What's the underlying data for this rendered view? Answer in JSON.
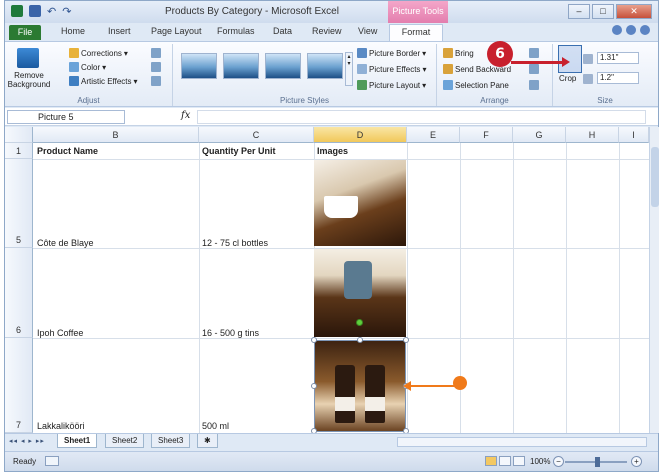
{
  "window": {
    "title": "Products By Category - Microsoft Excel",
    "context_tab": "Picture Tools",
    "buttons": [
      "–",
      "□",
      "✕"
    ]
  },
  "tabs": [
    "File",
    "Home",
    "Insert",
    "Page Layout",
    "Formulas",
    "Data",
    "Review",
    "View",
    "Format"
  ],
  "ribbon": {
    "adjust": {
      "remove_background": "Remove Background",
      "corrections": "Corrections",
      "color": "Color",
      "artistic_effects": "Artistic Effects",
      "label": "Adjust"
    },
    "picture_styles": {
      "picture_border": "Picture Border",
      "picture_effects": "Picture Effects",
      "picture_layout": "Picture Layout",
      "label": "Picture Styles"
    },
    "arrange": {
      "bring_forward": "Bring",
      "send_backward": "Send Backward",
      "selection_pane": "Selection Pane",
      "label": "Arrange"
    },
    "size": {
      "crop": "Crop",
      "height": "1.31\"",
      "width": "1.2\"",
      "label": "Size"
    }
  },
  "formula_bar": {
    "name_box": "Picture 5",
    "fx": "fx",
    "content": ""
  },
  "columns": [
    "B",
    "C",
    "D",
    "E",
    "F",
    "G",
    "H",
    "I"
  ],
  "selected_column": "D",
  "header_row": {
    "row": "1",
    "product_name": "Product Name",
    "quantity": "Quantity Per Unit",
    "images": "Images"
  },
  "rows": [
    {
      "row": "5",
      "name": "Côte de Blaye",
      "qty": "12 - 75 cl bottles"
    },
    {
      "row": "6",
      "name": "Ipoh Coffee",
      "qty": "16 - 500 g tins"
    },
    {
      "row": "7",
      "name": "Lakkalikööri",
      "qty": "500 ml"
    }
  ],
  "sheets": [
    "Sheet1",
    "Sheet2",
    "Sheet3"
  ],
  "status": {
    "ready": "Ready",
    "zoom": "100%"
  },
  "callout": {
    "step": "6"
  },
  "colors": {
    "accent_red": "#c8202d",
    "accent_orange": "#f07a1a",
    "file_tab": "#2b7a32",
    "context_pink": "#e37eae"
  }
}
